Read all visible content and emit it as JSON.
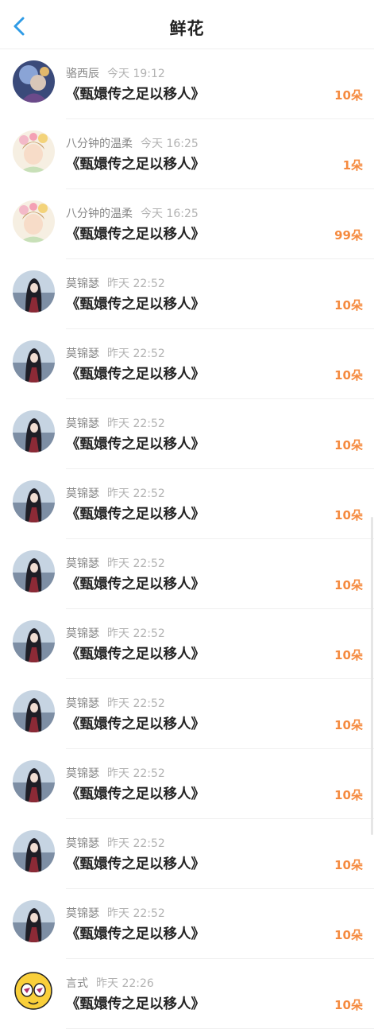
{
  "header": {
    "title": "鲜花",
    "back_icon": "chevron-left-icon",
    "accent_color": "#2f9be6"
  },
  "colors": {
    "amount": "#f58a3f",
    "username": "#888888",
    "time": "#b2b2b2",
    "title": "#222222"
  },
  "items": [
    {
      "username": "骆西辰",
      "time": "今天 19:12",
      "work_title": "《甄嬛传之足以移人》",
      "amount": "10朵",
      "avatar": "fantasy-avatar"
    },
    {
      "username": "八分钟的温柔",
      "time": "今天 16:25",
      "work_title": "《甄嬛传之足以移人》",
      "amount": "1朵",
      "avatar": "flower-girl-avatar"
    },
    {
      "username": "八分钟的温柔",
      "time": "今天 16:25",
      "work_title": "《甄嬛传之足以移人》",
      "amount": "99朵",
      "avatar": "flower-girl-avatar"
    },
    {
      "username": "莫锦瑟",
      "time": "昨天 22:52",
      "work_title": "《甄嬛传之足以移人》",
      "amount": "10朵",
      "avatar": "seaside-girl-avatar"
    },
    {
      "username": "莫锦瑟",
      "time": "昨天 22:52",
      "work_title": "《甄嬛传之足以移人》",
      "amount": "10朵",
      "avatar": "seaside-girl-avatar"
    },
    {
      "username": "莫锦瑟",
      "time": "昨天 22:52",
      "work_title": "《甄嬛传之足以移人》",
      "amount": "10朵",
      "avatar": "seaside-girl-avatar"
    },
    {
      "username": "莫锦瑟",
      "time": "昨天 22:52",
      "work_title": "《甄嬛传之足以移人》",
      "amount": "10朵",
      "avatar": "seaside-girl-avatar"
    },
    {
      "username": "莫锦瑟",
      "time": "昨天 22:52",
      "work_title": "《甄嬛传之足以移人》",
      "amount": "10朵",
      "avatar": "seaside-girl-avatar"
    },
    {
      "username": "莫锦瑟",
      "time": "昨天 22:52",
      "work_title": "《甄嬛传之足以移人》",
      "amount": "10朵",
      "avatar": "seaside-girl-avatar"
    },
    {
      "username": "莫锦瑟",
      "time": "昨天 22:52",
      "work_title": "《甄嬛传之足以移人》",
      "amount": "10朵",
      "avatar": "seaside-girl-avatar"
    },
    {
      "username": "莫锦瑟",
      "time": "昨天 22:52",
      "work_title": "《甄嬛传之足以移人》",
      "amount": "10朵",
      "avatar": "seaside-girl-avatar"
    },
    {
      "username": "莫锦瑟",
      "time": "昨天 22:52",
      "work_title": "《甄嬛传之足以移人》",
      "amount": "10朵",
      "avatar": "seaside-girl-avatar"
    },
    {
      "username": "莫锦瑟",
      "time": "昨天 22:52",
      "work_title": "《甄嬛传之足以移人》",
      "amount": "10朵",
      "avatar": "seaside-girl-avatar"
    },
    {
      "username": "言式",
      "time": "昨天 22:26",
      "work_title": "《甄嬛传之足以移人》",
      "amount": "10朵",
      "avatar": "cartoon-face-avatar"
    }
  ]
}
